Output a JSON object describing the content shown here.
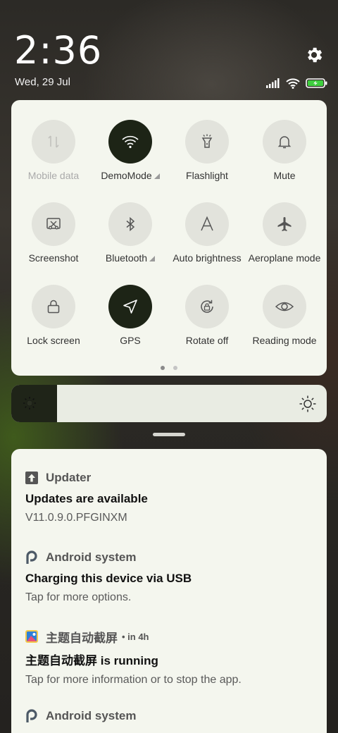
{
  "status_bar": {
    "time": "2:36",
    "date": "Wed, 29 Jul",
    "icons": [
      "signal-icon",
      "wifi-icon",
      "battery-charging-icon"
    ],
    "settings_icon": "gear-icon"
  },
  "quick_settings": {
    "tiles": [
      {
        "label": "Mobile data",
        "icon": "mobile-data-icon",
        "on": false,
        "dim": true,
        "expand": false
      },
      {
        "label": "DemoMode",
        "icon": "wifi-icon",
        "on": true,
        "dim": false,
        "expand": true
      },
      {
        "label": "Flashlight",
        "icon": "flashlight-icon",
        "on": false,
        "dim": false,
        "expand": false
      },
      {
        "label": "Mute",
        "icon": "bell-icon",
        "on": false,
        "dim": false,
        "expand": false
      },
      {
        "label": "Screenshot",
        "icon": "screenshot-icon",
        "on": false,
        "dim": false,
        "expand": false
      },
      {
        "label": "Bluetooth",
        "icon": "bluetooth-icon",
        "on": false,
        "dim": false,
        "expand": true
      },
      {
        "label": "Auto brightness",
        "icon": "auto-brightness-icon",
        "on": false,
        "dim": false,
        "expand": false
      },
      {
        "label": "Aeroplane mode",
        "icon": "airplane-icon",
        "on": false,
        "dim": false,
        "expand": false
      },
      {
        "label": "Lock screen",
        "icon": "lock-icon",
        "on": false,
        "dim": false,
        "expand": false
      },
      {
        "label": "GPS",
        "icon": "location-arrow-icon",
        "on": true,
        "dim": false,
        "expand": false
      },
      {
        "label": "Rotate off",
        "icon": "rotation-lock-icon",
        "on": false,
        "dim": false,
        "expand": false
      },
      {
        "label": "Reading mode",
        "icon": "eye-icon",
        "on": false,
        "dim": false,
        "expand": false
      }
    ],
    "pages": 2,
    "active_page": 1
  },
  "brightness": {
    "level": 0.145,
    "low_icon": "brightness-low-icon",
    "high_icon": "brightness-high-icon"
  },
  "notifications": [
    {
      "app": "Updater",
      "icon": "updater-icon",
      "when": "",
      "title": "Updates are available",
      "body": "V11.0.9.0.PFGINXM"
    },
    {
      "app": "Android system",
      "icon": "android-system-icon",
      "when": "",
      "title": "Charging this device via USB",
      "body": "Tap for more options."
    },
    {
      "app": "主题自动截屏",
      "icon": "theme-app-icon",
      "when": "• in 4h",
      "title": "主题自动截屏 is running",
      "body": "Tap for more information or to stop the app."
    },
    {
      "app": "Android system",
      "icon": "android-system-icon",
      "when": "",
      "title": "",
      "body": ""
    }
  ],
  "colors": {
    "panel_bg": "#f4f6ee",
    "tile_off": "#e2e3dc",
    "tile_on": "#1d2416",
    "battery_green": "#3ecf3e"
  }
}
